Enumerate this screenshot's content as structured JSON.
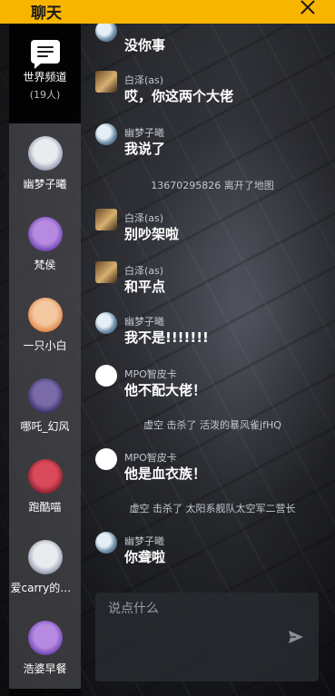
{
  "header": {
    "title": "聊天"
  },
  "sidebar": {
    "world": {
      "label": "世界频道",
      "count": "(19人)"
    },
    "contacts": [
      {
        "name": "幽梦子曦",
        "color": "#e9ecef",
        "ring": "#8b93a8"
      },
      {
        "name": "梵侯",
        "color": "#b58ae0",
        "ring": "#6a3fb0"
      },
      {
        "name": "一只小白",
        "color": "#f3c8a0",
        "ring": "#e08040"
      },
      {
        "name": "哪吒_幻风",
        "color": "#7a6aa8",
        "ring": "#3a2d68"
      },
      {
        "name": "跑酷喵",
        "color": "#d94a5a",
        "ring": "#8a1e2e"
      },
      {
        "name": "爱carry的小明",
        "color": "#e9ecef",
        "ring": "#8b93a8"
      },
      {
        "name": "浩婆早餐",
        "color": "#b58ae0",
        "ring": "#6a3fb0"
      }
    ]
  },
  "messages": [
    {
      "type": "user",
      "avatar": "youmeng",
      "name": "",
      "text": "没你事"
    },
    {
      "type": "user",
      "avatar": "baize",
      "name": "白泽(as)",
      "text": "哎，你这两个大佬"
    },
    {
      "type": "user",
      "avatar": "youmeng",
      "name": "幽梦子曦",
      "text": "我说了"
    },
    {
      "type": "system",
      "text": "13670295826 离开了地图"
    },
    {
      "type": "user",
      "avatar": "baize",
      "name": "白泽(as)",
      "text": "别吵架啦"
    },
    {
      "type": "user",
      "avatar": "baize",
      "name": "白泽(as)",
      "text": "和平点"
    },
    {
      "type": "user",
      "avatar": "youmeng",
      "name": "幽梦子曦",
      "text": "我不是!!!!!!!"
    },
    {
      "type": "user",
      "avatar": "mpo",
      "name": "MPO智皮卡",
      "text": "他不配大佬！"
    },
    {
      "type": "system",
      "text": "虚空 击杀了 活泼的暴风雀jfHQ"
    },
    {
      "type": "user",
      "avatar": "mpo",
      "name": "MPO智皮卡",
      "text": "他是血衣族！"
    },
    {
      "type": "system",
      "text": "虚空 击杀了 太阳系舰队太空军二营长"
    },
    {
      "type": "user",
      "avatar": "youmeng",
      "name": "幽梦子曦",
      "text": "你聋啦"
    }
  ],
  "input": {
    "placeholder": "说点什么",
    "value": ""
  },
  "colors": {
    "accent": "#f7b500"
  }
}
